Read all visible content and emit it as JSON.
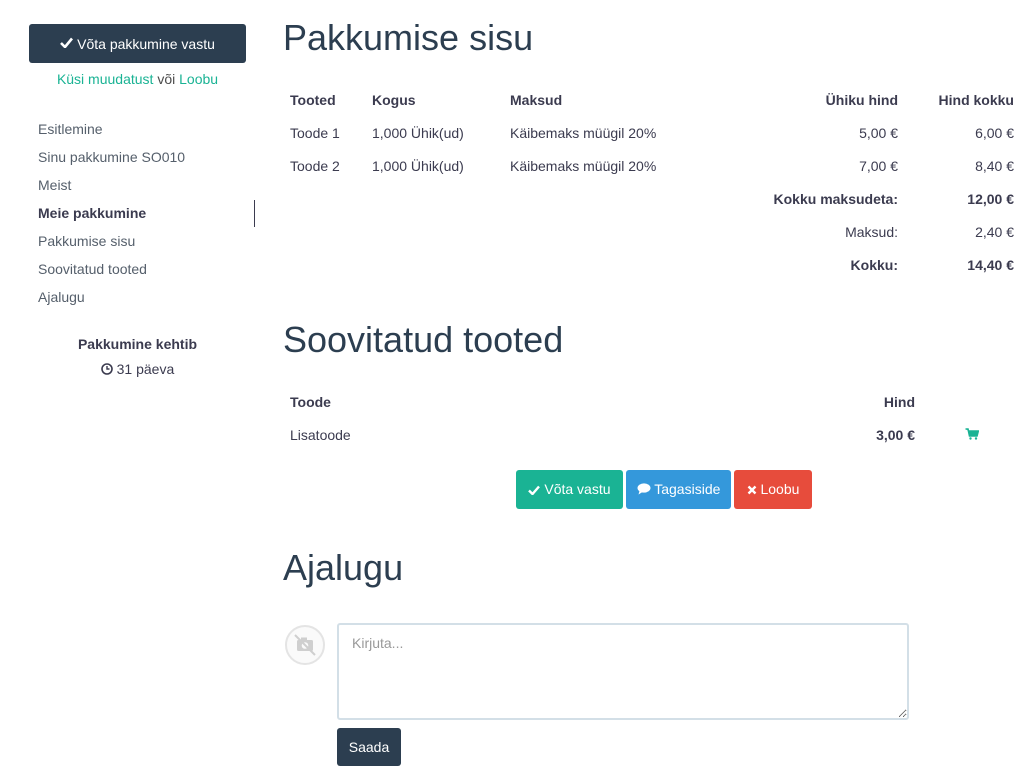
{
  "sidebar": {
    "accept_button": {
      "icon": "check-icon",
      "label": "Võta pakkumine vastu"
    },
    "ask_changes_link": "Küsi muudatust",
    "or_text": "või",
    "cancel_link": "Loobu",
    "nav": [
      {
        "label": "Esitlemine",
        "active": false
      },
      {
        "label": "Sinu pakkumine SO010",
        "active": false
      },
      {
        "label": "Meist",
        "active": false
      },
      {
        "label": "Meie pakkumine",
        "active": true
      },
      {
        "label": "Pakkumise sisu",
        "active": false
      },
      {
        "label": "Soovitatud tooted",
        "active": false
      },
      {
        "label": "Ajalugu",
        "active": false
      }
    ],
    "validity": {
      "title": "Pakkumine kehtib",
      "icon": "clock-icon",
      "days": "31 päeva"
    }
  },
  "content": {
    "title": "Pakkumise sisu",
    "table": {
      "headers": [
        "Tooted",
        "Kogus",
        "Maksud",
        "Ühiku hind",
        "Hind kokku"
      ],
      "rows": [
        [
          "Toode 1",
          "1,000 Ühik(ud)",
          "Käibemaks müügil 20%",
          "5,00 €",
          "6,00 €"
        ],
        [
          "Toode 2",
          "1,000 Ühik(ud)",
          "Käibemaks müügil 20%",
          "7,00 €",
          "8,40 €"
        ]
      ],
      "totals": [
        {
          "label": "Kokku maksudeta:",
          "value": "12,00 €",
          "bold": true
        },
        {
          "label": "Maksud:",
          "value": "2,40 €",
          "bold": false
        },
        {
          "label": "Kokku:",
          "value": "14,40 €",
          "bold": true
        }
      ]
    }
  },
  "suggested": {
    "title": "Soovitatud tooted",
    "headers": [
      "Toode",
      "Hind"
    ],
    "rows": [
      {
        "product": "Lisatoode",
        "price": "3,00 €",
        "icon": "cart-icon"
      }
    ]
  },
  "actions": {
    "accept": {
      "icon": "check-icon",
      "label": "Võta vastu",
      "color": "#1ab394"
    },
    "feedback": {
      "icon": "comment-icon",
      "label": "Tagasiside",
      "color": "#3498db"
    },
    "cancel": {
      "icon": "close-icon",
      "label": "Loobu",
      "color": "#e74c3c"
    }
  },
  "history": {
    "title": "Ajalugu",
    "avatar_icon": "no-photo-icon",
    "placeholder": "Kirjuta...",
    "send_label": "Saada"
  },
  "colors": {
    "primary_dark": "#2c3e50",
    "accent_green": "#1ab394",
    "accent_blue": "#3498db",
    "accent_red": "#e74c3c"
  }
}
